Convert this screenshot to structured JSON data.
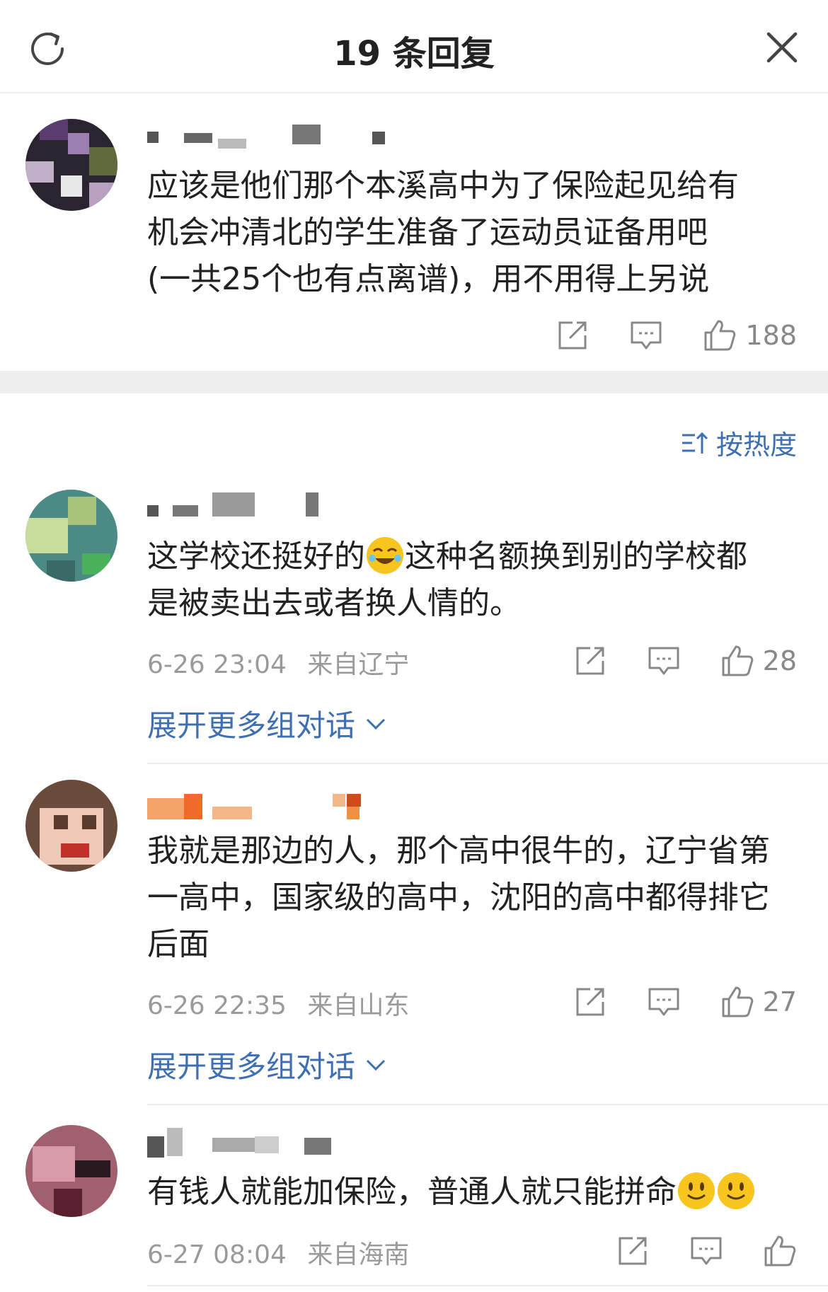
{
  "header": {
    "title": "19 条回复",
    "refresh_icon": "refresh-icon",
    "close_icon": "close-icon"
  },
  "root_comment": {
    "text_lines": [
      "应该是他们那个本溪高中为了保险起见给有",
      "机会冲清北的学生准备了运动员证备用吧",
      "(一共25个也有点离谱)，用不用得上另说"
    ],
    "likes": "188"
  },
  "sort": {
    "label": "按热度"
  },
  "replies": [
    {
      "text_lines": [
        "这学校还挺好的",
        "这种名额换到别的学校都",
        "是被卖出去或者换人情的。"
      ],
      "time": "6-26 23:04",
      "location": "来自辽宁",
      "likes": "28",
      "expand_label": "展开更多组对话"
    },
    {
      "text_lines": [
        "我就是那边的人，那个高中很牛的，辽宁省第",
        "一高中，国家级的高中，沈阳的高中都得排它",
        "后面"
      ],
      "time": "6-26 22:35",
      "location": "来自山东",
      "likes": "27",
      "expand_label": "展开更多组对话"
    },
    {
      "text_lines": [
        "有钱人就能加保险，普通人就只能拼命"
      ],
      "time": "6-27 08:04",
      "location": "来自海南",
      "likes": ""
    }
  ],
  "colors": {
    "link_blue": "#3f6fb3",
    "meta_gray": "#9a9a9a",
    "band_gray": "#eeeeee"
  }
}
